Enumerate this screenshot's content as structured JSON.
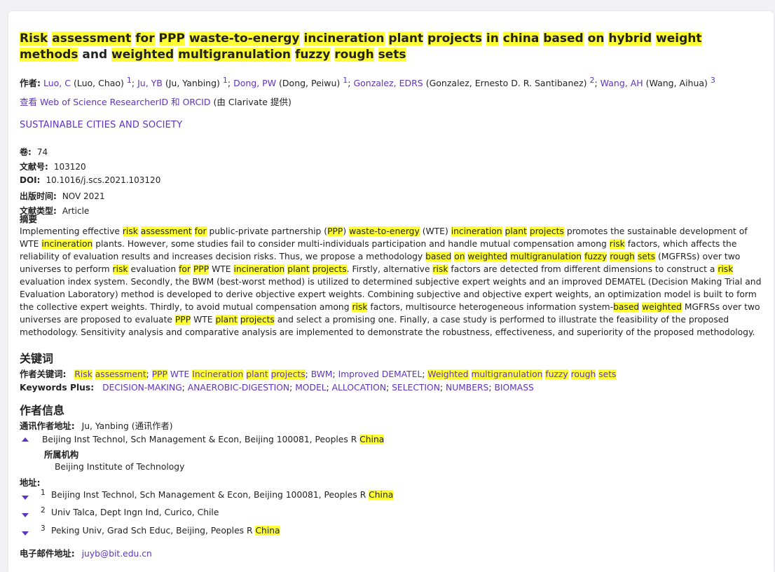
{
  "title_parts": [
    "Risk",
    "assessment",
    "for",
    "PPP",
    "waste-to-energy",
    "incineration",
    "plant",
    "projects",
    "in",
    "china",
    "based",
    "on",
    "hybrid",
    "weight",
    "methods",
    "and",
    "weighted",
    "multigranulation",
    "fuzzy",
    "rough",
    "sets"
  ],
  "authors": {
    "label": "作者:",
    "list": [
      {
        "short": "Luo, C",
        "full": "(Luo, Chao)",
        "sup": "1"
      },
      {
        "short": "Ju, YB",
        "full": "(Ju, Yanbing)",
        "sup": "1"
      },
      {
        "short": "Dong, PW",
        "full": "(Dong, Peiwu)",
        "sup": "1"
      },
      {
        "short": "Gonzalez, EDRS",
        "full": "(Gonzalez, Ernesto D. R. Santibanez)",
        "sup": "2"
      },
      {
        "short": "Wang, AH",
        "full": "(Wang, Aihua)",
        "sup": "3"
      }
    ],
    "researcher_link": "查看 Web of Science ResearcherID 和 ORCID",
    "researcher_note": "(由 Clarivate 提供)"
  },
  "journal": "SUSTAINABLE CITIES AND SOCIETY",
  "meta": {
    "volume_label": "卷:",
    "volume": "74",
    "article_no_label": "文献号:",
    "article_no": "103120",
    "doi_label": "DOI:",
    "doi": "10.1016/j.scs.2021.103120",
    "pub_date_label": "出版时间:",
    "pub_date": "NOV 2021",
    "doc_type_label": "文献类型:",
    "doc_type": "Article"
  },
  "abstract_label": "摘要",
  "abstract_text": "Implementing effective risk assessment for public-private partnership (PPP) waste-to-energy (WTE) incineration plant projects promotes the sustainable development of WTE incineration plants. However, some studies fail to consider multi-individuals participation and handle mutual compensation among risk factors, which affects the reliability of evaluation results and increases decision risks. Thus, we propose a methodology based on weighted multigranulation fuzzy rough sets (MGFRSs) over two universes to perform risk evaluation for PPP WTE incineration plant projects. Firstly, alternative risk factors are detected from different dimensions to construct a risk evaluation index system. Secondly, the BWM (best-worst method) is utilized to determined subjective expert weights and an improved DEMATEL (Decision Making Trial and Evaluation Laboratory) method is developed to derive objective expert weights. Combining subjective and objective expert weights, an optimization model is built to form the collective expert weights. Thirdly, to avoid mutual compensation among risk factors, multisource heterogeneous information system-based weighted MGFRSs over two universes are proposed to evaluate PPP WTE plant projects and select a promising one. Finally, a case study is performed to illustrate the feasibility of the proposed methodology. Sensitivity analysis and comparative analysis are implemented to demonstrate the robustness, effectiveness, and superiority of the proposed methodology.",
  "highlight_terms": [
    "risk",
    "assessment",
    "for",
    "PPP",
    "waste-to-energy",
    "incineration",
    "plant",
    "projects",
    "based",
    "on",
    "weighted",
    "multigranulation",
    "fuzzy",
    "rough",
    "sets",
    "china",
    "China",
    "Risk",
    "Incineration",
    "Weighted"
  ],
  "keywords": {
    "heading": "关键词",
    "author_kw_label": "作者关键词:",
    "author_kw": [
      "Risk assessment",
      "PPP WTE Incineration plant projects",
      "BWM",
      "Improved DEMATEL",
      "Weighted multigranulation fuzzy rough sets"
    ],
    "plus_label": "Keywords Plus:",
    "plus": [
      "DECISION-MAKING",
      "ANAEROBIC-DIGESTION",
      "MODEL",
      "ALLOCATION",
      "SELECTION",
      "NUMBERS",
      "BIOMASS"
    ]
  },
  "author_info": {
    "heading": "作者信息",
    "corr_label": "通讯作者地址:",
    "corr_name": "Ju, Yanbing",
    "corr_note": "(通讯作者)",
    "corr_addr": "Beijing Inst Technol, Sch Management & Econ, Beijing 100081, Peoples R China",
    "affil_label": "所属机构",
    "affil": "Beijing Institute of Technology",
    "addr_label": "地址:",
    "addresses": [
      {
        "n": "1",
        "text": "Beijing Inst Technol, Sch Management & Econ, Beijing 100081, Peoples R China"
      },
      {
        "n": "2",
        "text": "Univ Talca, Dept Ingn Ind, Curico, Chile"
      },
      {
        "n": "3",
        "text": "Peking Univ, Grad Sch Educ, Beijing, Peoples R China"
      }
    ],
    "email_label": "电子邮件地址:",
    "email": "juyb@bit.edu.cn"
  },
  "colors": {
    "accent": "#5e33bf",
    "highlight": "#ffff33"
  }
}
